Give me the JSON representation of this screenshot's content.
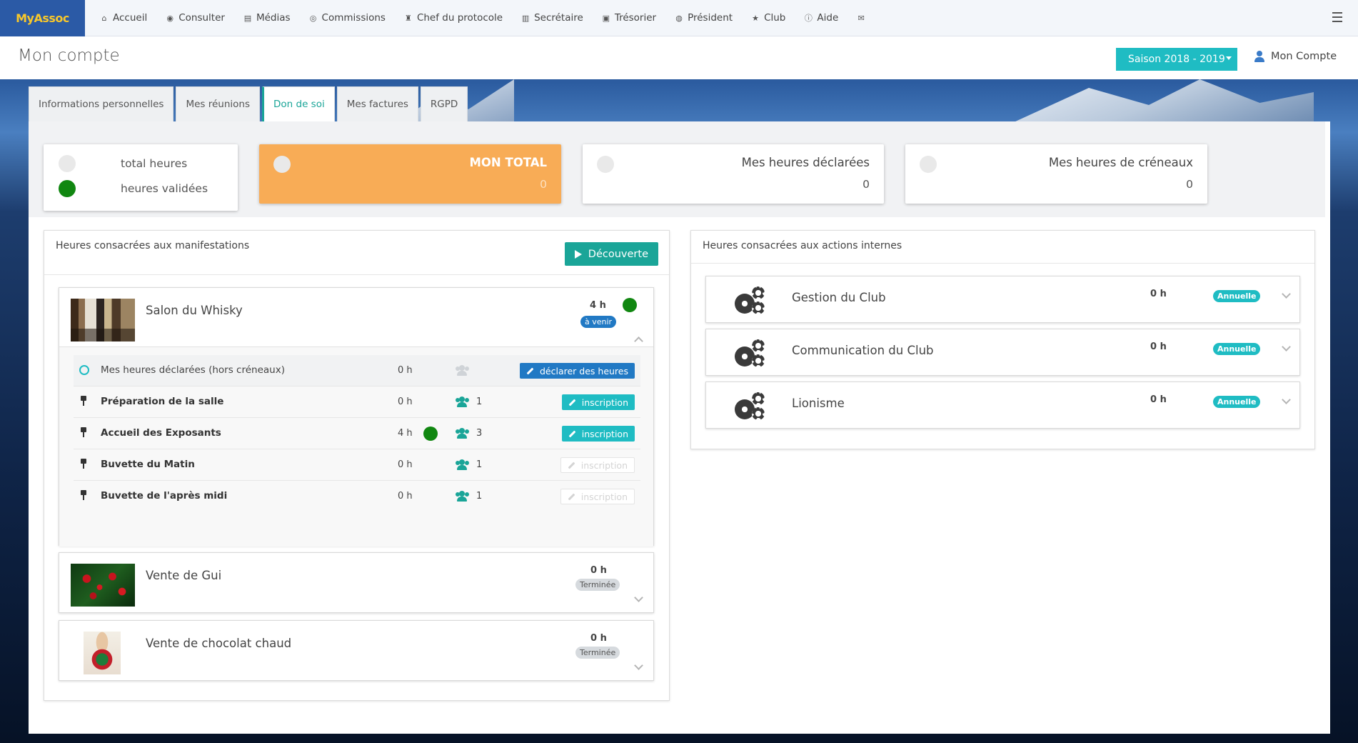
{
  "app": {
    "brand": "MyAssoc"
  },
  "nav": {
    "items": [
      {
        "label": "Accueil",
        "icon": "home-icon",
        "glyph": "⌂"
      },
      {
        "label": "Consulter",
        "icon": "eye-icon",
        "glyph": "◉"
      },
      {
        "label": "Médias",
        "icon": "file-icon",
        "glyph": "▤"
      },
      {
        "label": "Commissions",
        "icon": "user-circle-icon",
        "glyph": "◎"
      },
      {
        "label": "Chef du protocole",
        "icon": "trophy-icon",
        "glyph": "♜"
      },
      {
        "label": "Secrétaire",
        "icon": "book-icon",
        "glyph": "▥"
      },
      {
        "label": "Trésorier",
        "icon": "money-icon",
        "glyph": "▣"
      },
      {
        "label": "Président",
        "icon": "globe-icon",
        "glyph": "◍"
      },
      {
        "label": "Club",
        "icon": "star-icon",
        "glyph": "★"
      },
      {
        "label": "Aide",
        "icon": "info-icon",
        "glyph": "ⓘ"
      },
      {
        "label": "",
        "icon": "envelope-icon",
        "glyph": "✉"
      }
    ]
  },
  "header": {
    "title": "Mon compte",
    "season": "Saison 2018 - 2019",
    "account": "Mon Compte"
  },
  "tabs": [
    {
      "label": "Informations personnelles",
      "active": false
    },
    {
      "label": "Mes réunions",
      "active": false
    },
    {
      "label": "Don de soi",
      "active": true
    },
    {
      "label": "Mes factures",
      "active": false
    },
    {
      "label": "RGPD",
      "active": false
    }
  ],
  "legend": {
    "total": "total heures",
    "validated": "heures validées"
  },
  "stats": {
    "total": {
      "title": "MON TOTAL",
      "value": "0"
    },
    "declared": {
      "title": "Mes heures déclarées",
      "value": "0"
    },
    "slots": {
      "title": "Mes heures de créneaux",
      "value": "0"
    }
  },
  "manifestations": {
    "title": "Heures consacrées aux manifestations",
    "button": "Découverte",
    "events": [
      {
        "name": "Salon du Whisky",
        "hours": "4 h",
        "status": "à venir",
        "declared_row": {
          "label": "Mes heures déclarées (hors créneaux)",
          "hours": "0 h",
          "button": "déclarer des heures"
        },
        "slots": [
          {
            "name": "Préparation de la salle",
            "hours": "0 h",
            "count": "1",
            "button": "inscription",
            "enabled": true,
            "validated": false
          },
          {
            "name": "Accueil des Exposants",
            "hours": "4 h",
            "count": "3",
            "button": "inscription",
            "enabled": true,
            "validated": true
          },
          {
            "name": "Buvette du Matin",
            "hours": "0 h",
            "count": "1",
            "button": "inscription",
            "enabled": false,
            "validated": false
          },
          {
            "name": "Buvette de l'après midi",
            "hours": "0 h",
            "count": "1",
            "button": "inscription",
            "enabled": false,
            "validated": false
          }
        ]
      },
      {
        "name": "Vente de Gui",
        "hours": "0 h",
        "status": "Terminée"
      },
      {
        "name": "Vente de chocolat chaud",
        "hours": "0 h",
        "status": "Terminée"
      }
    ]
  },
  "internal": {
    "title": "Heures consacrées aux actions internes",
    "actions": [
      {
        "name": "Gestion du Club",
        "hours": "0 h",
        "badge": "Annuelle"
      },
      {
        "name": "Communication du Club",
        "hours": "0 h",
        "badge": "Annuelle"
      },
      {
        "name": "Lionisme",
        "hours": "0 h",
        "badge": "Annuelle"
      }
    ]
  },
  "colors": {
    "brand_bg": "#2b5aa6",
    "brand_text": "#f7c72b",
    "teal": "#1aa598",
    "cyan": "#1fbcc3",
    "blue": "#2179c4",
    "orange": "#f8ac56",
    "green": "#118711"
  }
}
